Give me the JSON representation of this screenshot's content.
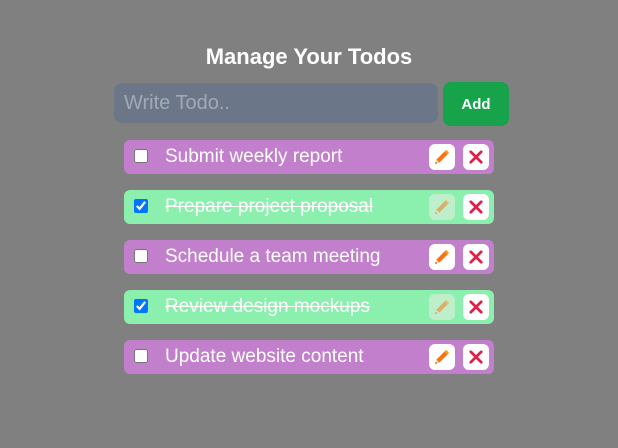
{
  "page": {
    "title": "Manage Your Todos"
  },
  "form": {
    "input_placeholder": "Write Todo..",
    "input_value": "",
    "add_label": "Add"
  },
  "todos": [
    {
      "text": "Submit weekly report",
      "completed": false
    },
    {
      "text": "Prepare project proposal",
      "completed": true
    },
    {
      "text": "Schedule a team meeting",
      "completed": false
    },
    {
      "text": "Review design mockups",
      "completed": true
    },
    {
      "text": "Update website content",
      "completed": false
    }
  ],
  "icons": {
    "edit": "pencil-icon",
    "delete": "close-icon"
  },
  "colors": {
    "background": "#808080",
    "pending_item": "#c27fcb",
    "completed_item": "#8bf0ae",
    "add_button": "#16a34a",
    "input_background": "#6b7688",
    "delete_icon": "#e11d48",
    "edit_icon": "#f97316"
  }
}
